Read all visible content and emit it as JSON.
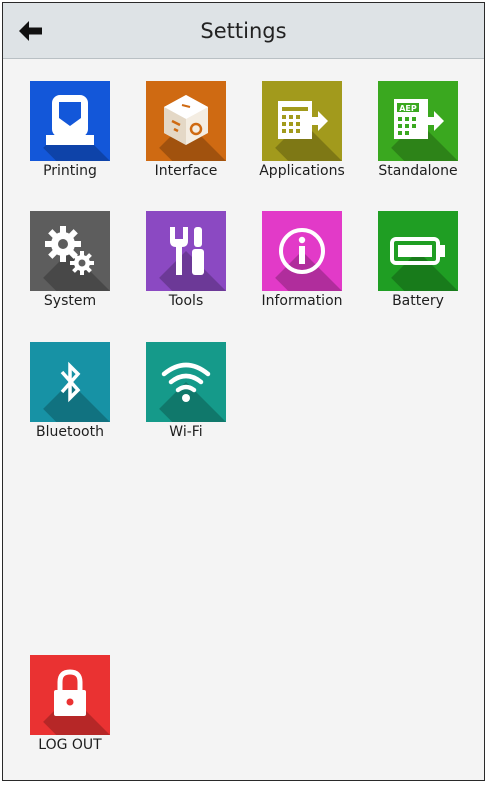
{
  "header": {
    "title": "Settings",
    "back_icon": "back-arrow-icon"
  },
  "tiles": [
    {
      "label": "Printing",
      "icon": "printer-icon",
      "color": "#1357d9"
    },
    {
      "label": "Interface",
      "icon": "cube-icon",
      "color": "#cf6a12"
    },
    {
      "label": "Applications",
      "icon": "application-icon",
      "color": "#a29a1c"
    },
    {
      "label": "Standalone",
      "icon": "aep-icon",
      "color": "#3aa81f"
    },
    {
      "label": "System",
      "icon": "gears-icon",
      "color": "#5d5d5d"
    },
    {
      "label": "Tools",
      "icon": "tools-icon",
      "color": "#8b49c2"
    },
    {
      "label": "Information",
      "icon": "info-icon",
      "color": "#e23ac8"
    },
    {
      "label": "Battery",
      "icon": "battery-icon",
      "color": "#1f9e23"
    },
    {
      "label": "Bluetooth",
      "icon": "bluetooth-icon",
      "color": "#1792a5"
    },
    {
      "label": "Wi-Fi",
      "icon": "wifi-icon",
      "color": "#159a8a"
    }
  ],
  "logout": {
    "label": "LOG OUT",
    "icon": "lock-icon",
    "color": "#ea3232"
  }
}
